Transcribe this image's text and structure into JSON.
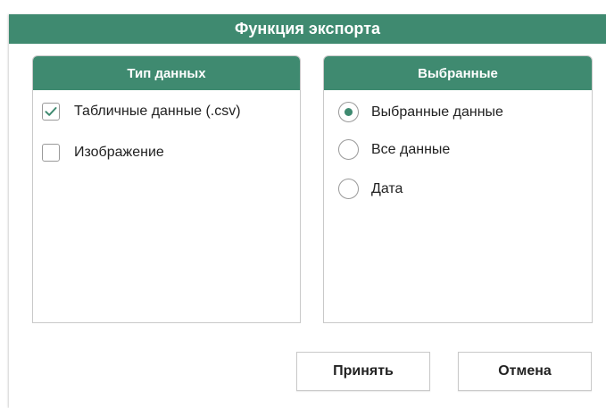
{
  "dialog": {
    "title": "Функция экспорта"
  },
  "data_type_panel": {
    "header": "Тип данных",
    "options": [
      {
        "label": "Табличные данные (.csv)",
        "checked": true
      },
      {
        "label": "Изображение",
        "checked": false
      }
    ]
  },
  "selection_panel": {
    "header": "Выбранные",
    "options": [
      {
        "label": "Выбранные данные",
        "selected": true
      },
      {
        "label": "Все данные",
        "selected": false
      },
      {
        "label": "Дата",
        "selected": false
      }
    ]
  },
  "buttons": {
    "accept_label": "Принять",
    "cancel_label": "Отмена"
  },
  "colors": {
    "accent": "#3f8a70",
    "border": "#c9c9c9"
  }
}
